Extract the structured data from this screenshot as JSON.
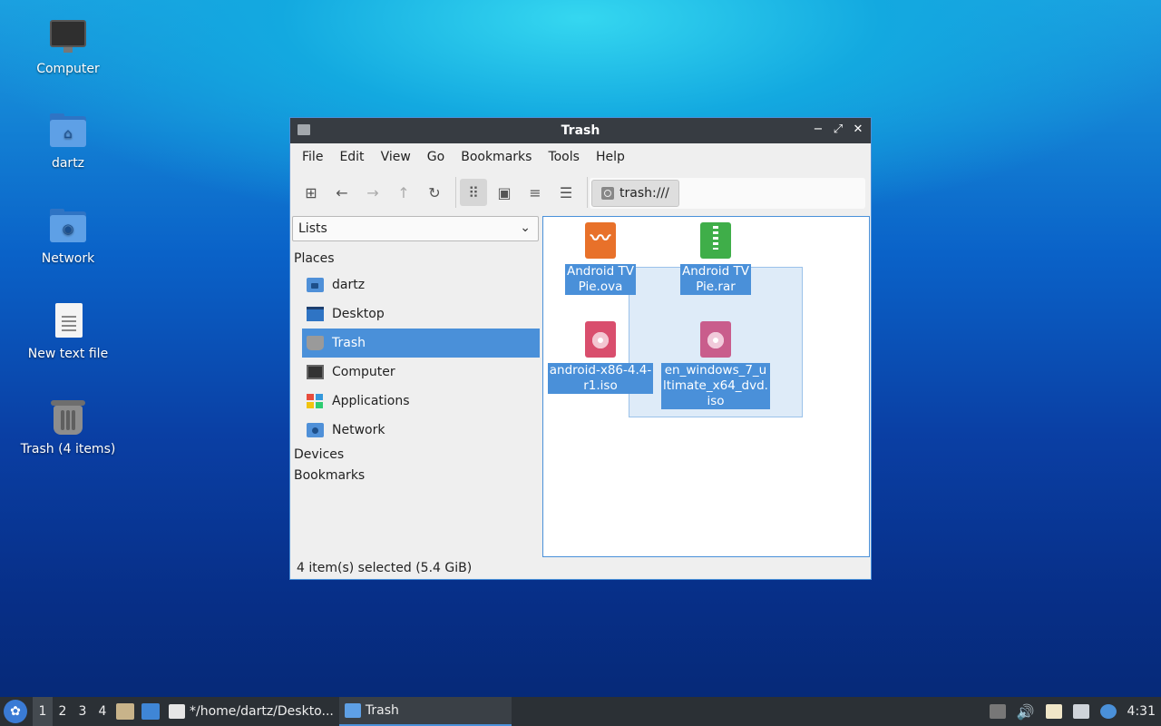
{
  "desktop": {
    "icons": [
      {
        "label": "Computer",
        "icon": "computer-icon"
      },
      {
        "label": "dartz",
        "icon": "home-folder-icon"
      },
      {
        "label": "Network",
        "icon": "network-folder-icon"
      },
      {
        "label": "New text file",
        "icon": "text-file-icon"
      },
      {
        "label": "Trash (4 items)",
        "icon": "trash-icon"
      }
    ]
  },
  "window": {
    "title": "Trash",
    "controls": {
      "minimize": "−",
      "maximize": "⤢",
      "close": "✕"
    },
    "menu": [
      "File",
      "Edit",
      "View",
      "Go",
      "Bookmarks",
      "Tools",
      "Help"
    ],
    "toolbar": {
      "icons": [
        "new-tab-icon",
        "back-icon",
        "forward-icon",
        "up-icon",
        "reload-icon",
        "icon-view-icon",
        "thumbnail-view-icon",
        "compact-view-icon",
        "detailed-list-icon"
      ],
      "path": "trash:///"
    },
    "sidebar": {
      "mode": "Lists",
      "sections": {
        "places": "Places",
        "devices": "Devices",
        "bookmarks": "Bookmarks"
      },
      "places": [
        {
          "label": "dartz",
          "icon": "home-folder-icon"
        },
        {
          "label": "Desktop",
          "icon": "desktop-icon"
        },
        {
          "label": "Trash",
          "icon": "trash-icon",
          "selected": true
        },
        {
          "label": "Computer",
          "icon": "computer-icon"
        },
        {
          "label": "Applications",
          "icon": "applications-icon"
        },
        {
          "label": "Network",
          "icon": "network-icon"
        }
      ]
    },
    "files": [
      {
        "name_line1": "Android TV",
        "name_line2": "Pie.ova",
        "type": "ova-file-icon"
      },
      {
        "name_line1": "Android TV",
        "name_line2": "Pie.rar",
        "type": "archive-icon"
      },
      {
        "name_line1": "android-x86-4.4-",
        "name_line2": "r1.iso",
        "type": "disc-image-icon"
      },
      {
        "name_line1": "en_windows_7_u",
        "name_line2": "ltimate_x64_dvd.",
        "name_line3": "iso",
        "type": "disc-image-icon"
      }
    ],
    "status": "4 item(s) selected (5.4 GiB)"
  },
  "taskbar": {
    "workspaces": [
      "1",
      "2",
      "3",
      "4"
    ],
    "active_workspace": "1",
    "tasks": [
      {
        "label": "*/home/dartz/Deskto...",
        "icon": "text-editor-icon"
      },
      {
        "label": "Trash",
        "icon": "folder-icon",
        "active": true
      }
    ],
    "clock": "4:31"
  },
  "colors": {
    "selection": "#4a90d9",
    "titlebar": "#373c42",
    "taskbar": "#2b3035"
  }
}
